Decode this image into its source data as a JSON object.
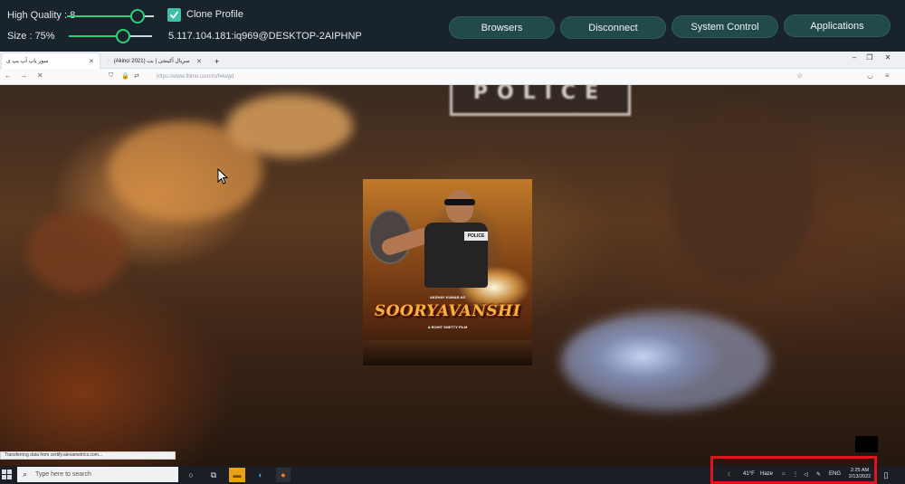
{
  "toolbar": {
    "quality_label": "High Quality : 8",
    "size_label": "Size : 75%",
    "clone_profile_label": "Clone Profile",
    "connection": "5.117.104.181:iq969@DESKTOP-2AIPHNP",
    "buttons": {
      "browsers": "Browsers",
      "disconnect": "Disconnect",
      "system_control": "System Control",
      "applications": "Applications"
    },
    "accent_color": "#2fd07a"
  },
  "browser": {
    "tabs": [
      {
        "label": "سور پاپ آپ یپ ی",
        "active": true
      },
      {
        "label": "(Akinci 2021) سریال آکینجی | بت",
        "active": false
      }
    ],
    "new_tab": "+",
    "url": "https://www.filimo.com/m/h4wgd",
    "win_controls": [
      "–",
      "❐",
      "✕"
    ]
  },
  "page": {
    "police_sign": "POLICE",
    "poster": {
      "credit": "AKSHAY KUMAR AS",
      "badge": "POLICE",
      "title": "SOORYAVANSHI",
      "subtitle": "A ROHIT SHETTY FILM"
    },
    "status_text": "Transferring data from certify.alexametrics.com..."
  },
  "taskbar": {
    "search_placeholder": "Type here to search",
    "weather_temp": "41°F",
    "weather_desc": "Haze",
    "language": "ENG",
    "time": "2:25 AM",
    "date": "2/13/2022"
  },
  "highlight_color": "#e0141c"
}
